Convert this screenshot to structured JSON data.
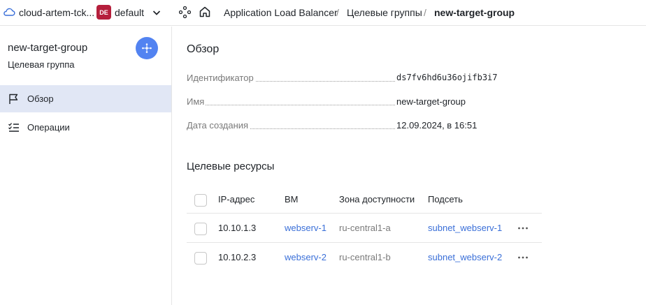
{
  "header": {
    "cloud_name": "cloud-artem-tck...",
    "folder_badge": "DE",
    "folder_name": "default",
    "breadcrumbs": [
      "Application Load Balancer",
      "Целевые группы",
      "new-target-group"
    ],
    "separator": "/"
  },
  "sidebar": {
    "title": "new-target-group",
    "subtitle": "Целевая группа",
    "items": [
      {
        "label": "Обзор",
        "icon": "flag-icon",
        "active": true
      },
      {
        "label": "Операции",
        "icon": "operations-list-icon",
        "active": false
      }
    ]
  },
  "overview": {
    "title": "Обзор",
    "properties": [
      {
        "key": "Идентификатор",
        "value": "ds7fv6hd6u36ojifb3i7"
      },
      {
        "key": "Имя",
        "value": "new-target-group"
      },
      {
        "key": "Дата создания",
        "value": "12.09.2024, в 16:51"
      }
    ]
  },
  "targets": {
    "title": "Целевые ресурсы",
    "columns": [
      "IP-адрес",
      "ВМ",
      "Зона доступности",
      "Подсеть"
    ],
    "rows": [
      {
        "ip": "10.10.1.3",
        "vm": "webserv-1",
        "zone": "ru-central1-a",
        "subnet": "subnet_webserv-1"
      },
      {
        "ip": "10.10.2.3",
        "vm": "webserv-2",
        "zone": "ru-central1-b",
        "subnet": "subnet_webserv-2"
      }
    ]
  },
  "colors": {
    "accent": "#5283f1",
    "active_bg": "#e1e7f5",
    "badge": "#b51f3c",
    "link": "#3a6fd8"
  }
}
